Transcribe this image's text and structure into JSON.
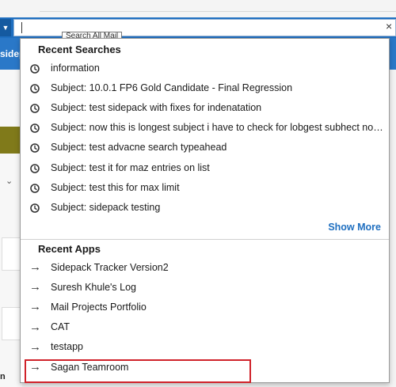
{
  "search": {
    "tooltip": "Search All Mail"
  },
  "background": {
    "sidebar_label": "sidep",
    "bottom_left_label": "n"
  },
  "recent_searches": {
    "title": "Recent Searches",
    "items": [
      "information",
      "Subject: 10.0.1 FP6 Gold Candidate - Final Regression",
      "Subject: test sidepack with fixes for indenatation",
      "Subject: now this is longest subject i have to check for lobgest subhect now this is long",
      "Subject: test advacne search typeahead",
      "Subject: test it for maz entries on list",
      "Subject: test this for max limit",
      "Subject: sidepack testing"
    ],
    "show_more": "Show More",
    "icon": "clock-icon"
  },
  "recent_apps": {
    "title": "Recent Apps",
    "items": [
      "Sidepack Tracker Version2",
      "Suresh Khule's Log",
      "Mail Projects Portfolio",
      "CAT",
      "testapp",
      "Sagan Teamroom"
    ],
    "icon": "arrow-right-icon",
    "highlighted_item": "Sagan Teamroom"
  },
  "colors": {
    "accent": "#1f6fc0",
    "highlight_border": "#d0222a"
  }
}
